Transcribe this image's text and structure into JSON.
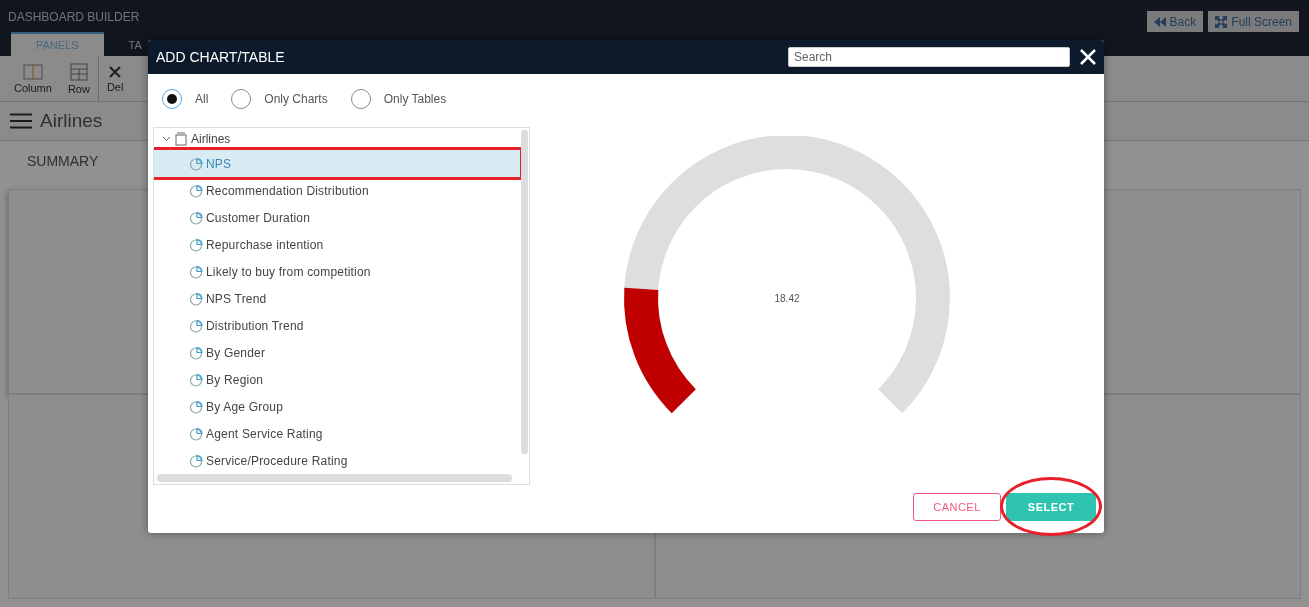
{
  "app": {
    "title": "DASHBOARD BUILDER",
    "header_buttons": [
      {
        "kind": "back",
        "label": "Back"
      },
      {
        "kind": "fullscreen",
        "label": "Full Screen"
      }
    ],
    "tabs": [
      {
        "label": "PANELS",
        "selected": true
      },
      {
        "label": "TA",
        "selected": false
      }
    ],
    "toolbar": [
      {
        "kind": "column",
        "label": "Column"
      },
      {
        "kind": "row",
        "label": "Row"
      },
      {
        "kind": "delete",
        "label": "Del"
      }
    ],
    "dashboard_title": "Airlines",
    "section_tab": "SUMMARY"
  },
  "dialog": {
    "title": "ADD CHART/TABLE",
    "search": {
      "placeholder": "Search"
    },
    "filters": [
      {
        "label": "All",
        "selected": true
      },
      {
        "label": "Only Charts",
        "selected": false
      },
      {
        "label": "Only Tables",
        "selected": false
      }
    ],
    "tree": {
      "label": "Airlines",
      "expanded": true,
      "children": [
        {
          "label": "NPS",
          "selected": true,
          "annotated": true
        },
        {
          "label": "Recommendation Distribution",
          "selected": false,
          "annotated": false
        },
        {
          "label": "Customer Duration",
          "selected": false,
          "annotated": false
        },
        {
          "label": "Repurchase intention",
          "selected": false,
          "annotated": false
        },
        {
          "label": "Likely to buy from competition",
          "selected": false,
          "annotated": false
        },
        {
          "label": "NPS Trend",
          "selected": false,
          "annotated": false
        },
        {
          "label": "Distribution Trend",
          "selected": false,
          "annotated": false
        },
        {
          "label": "By Gender",
          "selected": false,
          "annotated": false
        },
        {
          "label": "By Region",
          "selected": false,
          "annotated": false
        },
        {
          "label": "By Age Group",
          "selected": false,
          "annotated": false
        },
        {
          "label": "Agent Service Rating",
          "selected": false,
          "annotated": false
        },
        {
          "label": "Service/Procedure Rating",
          "selected": false,
          "annotated": false
        }
      ]
    },
    "preview": {
      "value": "18.42",
      "level": 0.18
    },
    "buttons": [
      {
        "kind": "cancel",
        "label": "CANCEL",
        "annotated": false
      },
      {
        "kind": "select",
        "label": "SELECT",
        "annotated": true
      }
    ]
  }
}
